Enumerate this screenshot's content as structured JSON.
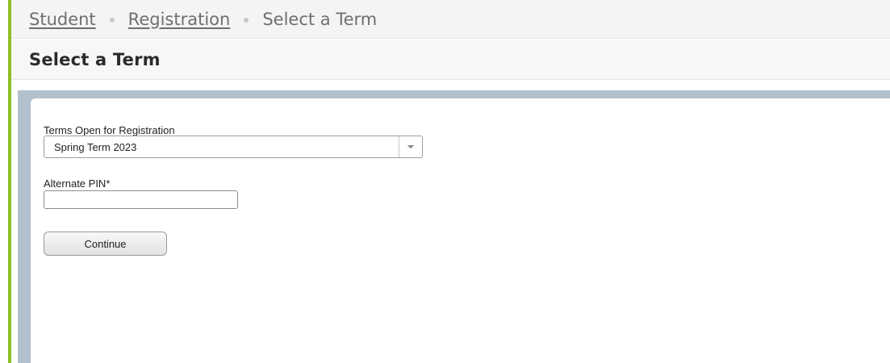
{
  "breadcrumb": {
    "items": [
      {
        "label": "Student"
      },
      {
        "label": "Registration"
      },
      {
        "label": "Select a Term"
      }
    ]
  },
  "page": {
    "title": "Select a Term"
  },
  "form": {
    "term_label": "Terms Open for Registration",
    "term_selected": "Spring Term 2023",
    "term_icon": "chevron-down-icon",
    "pin_label": "Alternate PIN*",
    "pin_value": "",
    "continue_label": "Continue"
  },
  "colors": {
    "accent": "#8cbf26",
    "frame": "#b1c0cc"
  }
}
